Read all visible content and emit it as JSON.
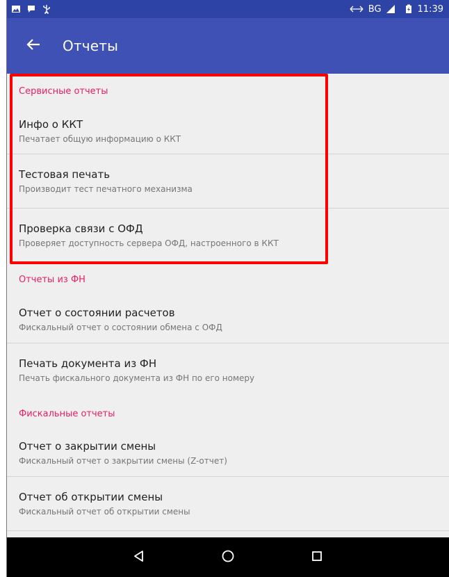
{
  "status_bar": {
    "network_label": "BG",
    "time": "11:39"
  },
  "toolbar": {
    "title": "Отчеты"
  },
  "sections": [
    {
      "header": "Сервисные отчеты",
      "items": [
        {
          "title": "Инфо о ККТ",
          "subtitle": "Печатает общую информацию о ККТ"
        },
        {
          "title": "Тестовая печать",
          "subtitle": "Производит тест печатного механизма"
        },
        {
          "title": "Проверка связи с ОФД",
          "subtitle": "Проверяет доступность сервера ОФД, настроенного в ККТ"
        }
      ]
    },
    {
      "header": "Отчеты из ФН",
      "items": [
        {
          "title": "Отчет о состоянии расчетов",
          "subtitle": "Фискальный отчет о состоянии обмена с ОФД"
        },
        {
          "title": "Печать документа из ФН",
          "subtitle": "Печать фискального документа из ФН по его номеру"
        }
      ]
    },
    {
      "header": "Фискальные отчеты",
      "items": [
        {
          "title": "Отчет о закрытии смены",
          "subtitle": "Фискальный отчет о закрытии смены (Z-отчет)"
        },
        {
          "title": "Отчет об открытии смены",
          "subtitle": "Фискальный отчет об открытии смены"
        }
      ]
    }
  ],
  "colors": {
    "status_bar": "#2e43a6",
    "toolbar": "#3f51b5",
    "section_header": "#e91e63",
    "highlight_box": "#ff0000",
    "background": "#efefef"
  },
  "icons": {
    "back": "arrow-left-icon",
    "nav_back": "triangle-back-icon",
    "nav_home": "circle-home-icon",
    "nav_recents": "square-recents-icon"
  }
}
